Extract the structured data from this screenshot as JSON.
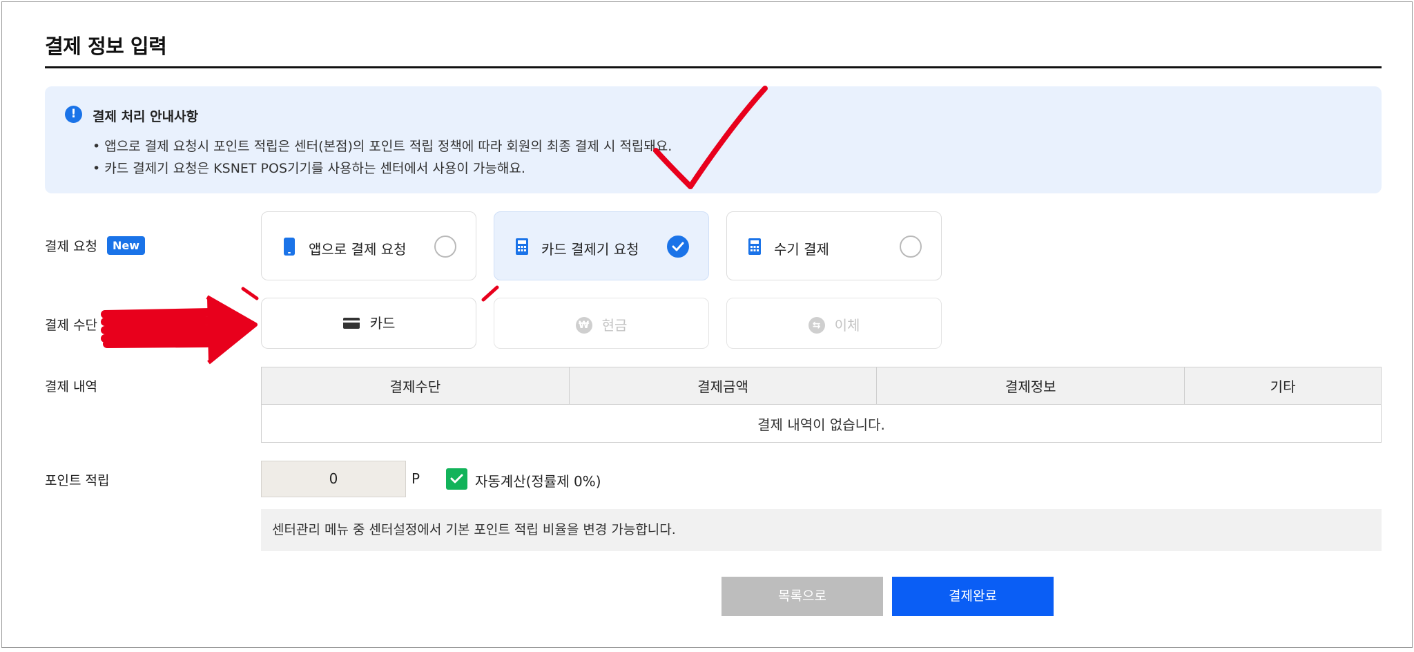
{
  "page": {
    "title": "결제 정보 입력"
  },
  "notice": {
    "title": "결제 처리 안내사항",
    "bullet": "•",
    "lines": [
      "앱으로 결제 요청시 포인트 적립은 센터(본점)의 포인트 적립 정책에 따라 회원의 최종 결제 시 적립돼요.",
      "카드 결제기 요청은 KSNET POS기기를 사용하는 센터에서 사용이 가능해요."
    ]
  },
  "payment_request": {
    "label": "결제 요청",
    "badge": "New",
    "options": [
      {
        "label": "앱으로 결제 요청",
        "icon": "phone-icon",
        "selected": false
      },
      {
        "label": "카드 결제기 요청",
        "icon": "calculator-icon",
        "selected": true
      },
      {
        "label": "수기 결제",
        "icon": "calculator-icon",
        "selected": false
      }
    ]
  },
  "payment_method": {
    "label": "결제 수단",
    "options": [
      {
        "label": "카드",
        "icon": "card-icon",
        "enabled": true
      },
      {
        "label": "현금",
        "icon": "won-icon",
        "enabled": false
      },
      {
        "label": "이체",
        "icon": "transfer-icon",
        "enabled": false
      }
    ]
  },
  "history": {
    "label": "결제 내역",
    "columns": [
      "결제수단",
      "결제금액",
      "결제정보",
      "기타"
    ],
    "empty_message": "결제 내역이 없습니다."
  },
  "points": {
    "label": "포인트 적립",
    "value": "0",
    "unit": "P",
    "auto_label": "자동계산(정률제 0%)",
    "auto_checked": true,
    "hint": "센터관리 메뉴 중 센터설정에서 기본 포인트 적립 비율을 변경 가능합니다."
  },
  "buttons": {
    "list": "목록으로",
    "complete": "결제완료"
  },
  "colors": {
    "accent": "#1a73e8",
    "primary_button": "#0a5ef5",
    "check_green": "#12b35a",
    "annotation_red": "#e8001c"
  }
}
